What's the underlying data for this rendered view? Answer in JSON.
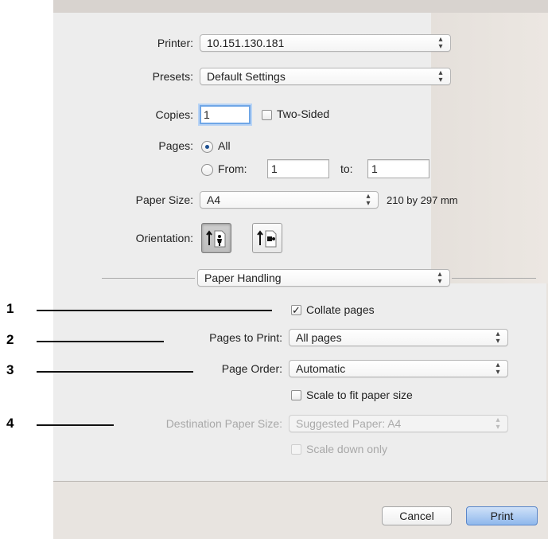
{
  "printer": {
    "label": "Printer:",
    "value": "10.151.130.181"
  },
  "presets": {
    "label": "Presets:",
    "value": "Default Settings"
  },
  "copies": {
    "label": "Copies:",
    "value": "1",
    "two_sided_label": "Two-Sided",
    "two_sided_checked": false
  },
  "pages": {
    "label": "Pages:",
    "all_label": "All",
    "from_label": "From:",
    "from_value": "1",
    "to_label": "to:",
    "to_value": "1",
    "selected": "All"
  },
  "paper_size": {
    "label": "Paper Size:",
    "value": "A4",
    "dimensions": "210 by 297 mm"
  },
  "orientation": {
    "label": "Orientation:",
    "options": [
      "portrait-icon",
      "landscape-icon"
    ],
    "selected": "portrait-icon"
  },
  "section_popup": {
    "value": "Paper Handling"
  },
  "paper_handling": {
    "collate_label": "Collate pages",
    "collate_checked": true,
    "pages_to_print_label": "Pages to Print:",
    "pages_to_print_value": "All pages",
    "page_order_label": "Page Order:",
    "page_order_value": "Automatic",
    "scale_fit_label": "Scale to fit paper size",
    "scale_fit_checked": false,
    "dest_paper_label": "Destination Paper Size:",
    "dest_paper_value": "Suggested Paper: A4",
    "scale_down_label": "Scale down only",
    "scale_down_checked": false
  },
  "buttons": {
    "cancel": "Cancel",
    "print": "Print"
  },
  "callouts": [
    "1",
    "2",
    "3",
    "4"
  ],
  "popup_arrows_glyph": "⌃\n⌄",
  "check_glyph": "✓",
  "colors": {
    "default_button": "#8fb8ec",
    "focus_ring": "#6fa6e6"
  }
}
